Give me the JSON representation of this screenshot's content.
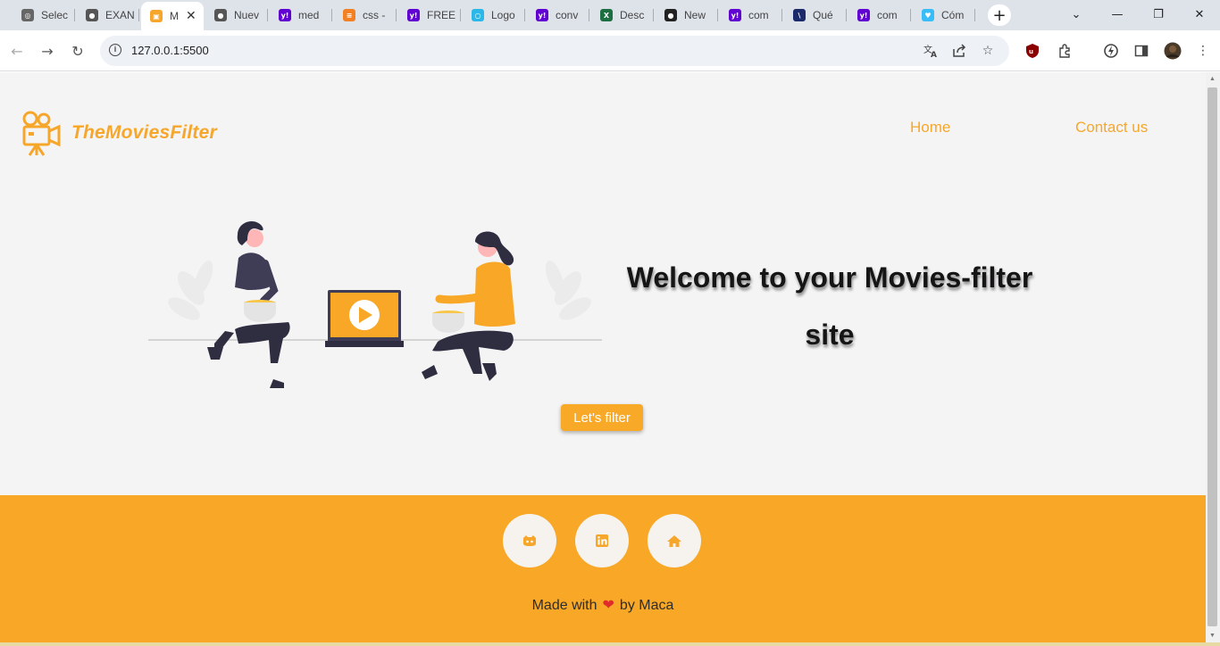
{
  "browser": {
    "tabs": [
      {
        "title": "Selec",
        "icon": "chatgpt-icon",
        "color": "#666666",
        "glyph": "◎"
      },
      {
        "title": "EXAN",
        "icon": "globe-icon",
        "color": "#555555",
        "glyph": "●"
      },
      {
        "title": "M",
        "icon": "movie-app-icon",
        "color": "#f6a72b",
        "glyph": "▣",
        "active": true
      },
      {
        "title": "Nuev",
        "icon": "globe-icon",
        "color": "#555555",
        "glyph": "●"
      },
      {
        "title": "med",
        "icon": "yahoo-icon",
        "color": "#6001d2",
        "glyph": "y!"
      },
      {
        "title": "css -",
        "icon": "stackoverflow-icon",
        "color": "#f48024",
        "glyph": "≡"
      },
      {
        "title": "FREE",
        "icon": "yahoo-icon",
        "color": "#6001d2",
        "glyph": "y!"
      },
      {
        "title": "Logo",
        "icon": "logo-site-icon",
        "color": "#2bb8e8",
        "glyph": "○"
      },
      {
        "title": "conv",
        "icon": "yahoo-icon",
        "color": "#6001d2",
        "glyph": "y!"
      },
      {
        "title": "Desc",
        "icon": "excel-icon",
        "color": "#1d6f42",
        "glyph": "X"
      },
      {
        "title": "New",
        "icon": "github-icon",
        "color": "#222222",
        "glyph": "●"
      },
      {
        "title": "com",
        "icon": "yahoo-icon",
        "color": "#6001d2",
        "glyph": "y!"
      },
      {
        "title": "Qué",
        "icon": "docs-icon",
        "color": "#1b2a6b",
        "glyph": "\\"
      },
      {
        "title": "com",
        "icon": "yahoo-icon",
        "color": "#6001d2",
        "glyph": "y!"
      },
      {
        "title": "Cóm",
        "icon": "tailwind-icon",
        "color": "#38bdf8",
        "glyph": "♥"
      }
    ],
    "new_tab": "+",
    "url": "127.0.0.1:5500"
  },
  "site": {
    "brand": "TheMoviesFilter",
    "nav": {
      "home": "Home",
      "contact": "Contact us"
    },
    "hero": {
      "title_line1": "Welcome to your Movies-filter",
      "title_line2": "site",
      "cta": "Let's filter"
    },
    "footer": {
      "credit_prefix": "Made with",
      "credit_suffix": "by Maca"
    }
  },
  "colors": {
    "accent": "#f8a726",
    "page_bg": "#f5f4f5"
  }
}
